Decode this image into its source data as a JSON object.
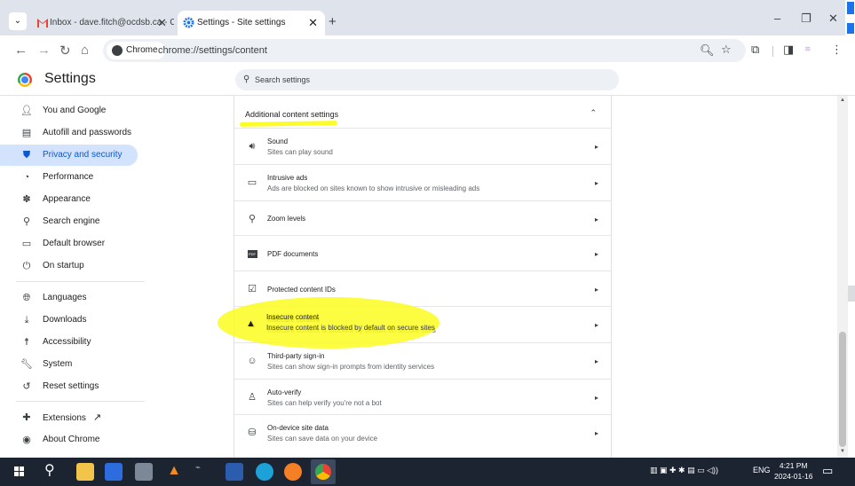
{
  "browser": {
    "tabs": [
      {
        "title": "Inbox - dave.fitch@ocdsb.ca - C",
        "close": "✕"
      },
      {
        "title": "Settings - Site settings",
        "close": "✕"
      }
    ],
    "new_tab": "+",
    "window_controls": {
      "minimize": "–",
      "restore": "❐",
      "close": "✕"
    },
    "chip_label": "Chrome",
    "url": "chrome://settings/content"
  },
  "settings": {
    "title": "Settings",
    "search_placeholder": "Search settings",
    "sidebar": [
      {
        "label": "You and Google",
        "icon": "person-icon"
      },
      {
        "label": "Autofill and passwords",
        "icon": "clipboard-icon"
      },
      {
        "label": "Privacy and security",
        "icon": "shield-icon",
        "active": true
      },
      {
        "label": "Performance",
        "icon": "speedometer-icon"
      },
      {
        "label": "Appearance",
        "icon": "palette-icon"
      },
      {
        "label": "Search engine",
        "icon": "search-icon"
      },
      {
        "label": "Default browser",
        "icon": "browser-icon"
      },
      {
        "label": "On startup",
        "icon": "power-icon"
      },
      {
        "label": "Languages",
        "icon": "globe-icon"
      },
      {
        "label": "Downloads",
        "icon": "download-icon"
      },
      {
        "label": "Accessibility",
        "icon": "accessibility-icon"
      },
      {
        "label": "System",
        "icon": "wrench-icon"
      },
      {
        "label": "Reset settings",
        "icon": "reset-icon"
      },
      {
        "label": "Extensions",
        "icon": "puzzle-icon"
      },
      {
        "label": "About Chrome",
        "icon": "chrome-icon"
      }
    ],
    "section_title": "Additional content settings",
    "rows": [
      {
        "title": "Sound",
        "subtitle": "Sites can play sound",
        "icon": "speaker-icon"
      },
      {
        "title": "Intrusive ads",
        "subtitle": "Ads are blocked on sites known to show intrusive or misleading ads",
        "icon": "ad-window-icon"
      },
      {
        "title": "Zoom levels",
        "subtitle": "",
        "icon": "zoom-icon"
      },
      {
        "title": "PDF documents",
        "subtitle": "",
        "icon": "pdf-icon"
      },
      {
        "title": "Protected content IDs",
        "subtitle": "",
        "icon": "protected-content-icon"
      },
      {
        "title": "Insecure content",
        "subtitle": "Insecure content is blocked by default on secure sites",
        "icon": "warning-icon"
      },
      {
        "title": "Third-party sign-in",
        "subtitle": "Sites can show sign-in prompts from identity services",
        "icon": "account-circle-icon"
      },
      {
        "title": "Auto-verify",
        "subtitle": "Sites can help verify you're not a bot",
        "icon": "person-check-icon"
      },
      {
        "title": "On-device site data",
        "subtitle": "Sites can save data on your device",
        "icon": "database-icon"
      }
    ]
  },
  "taskbar": {
    "lang": "ENG",
    "time": "4:21 PM",
    "date": "2024-01-16"
  },
  "colors": {
    "accent": "#0b57d0",
    "active_bg": "#d3e3fd",
    "highlight": "#fcfc1e",
    "taskbar": "#1c2431"
  }
}
